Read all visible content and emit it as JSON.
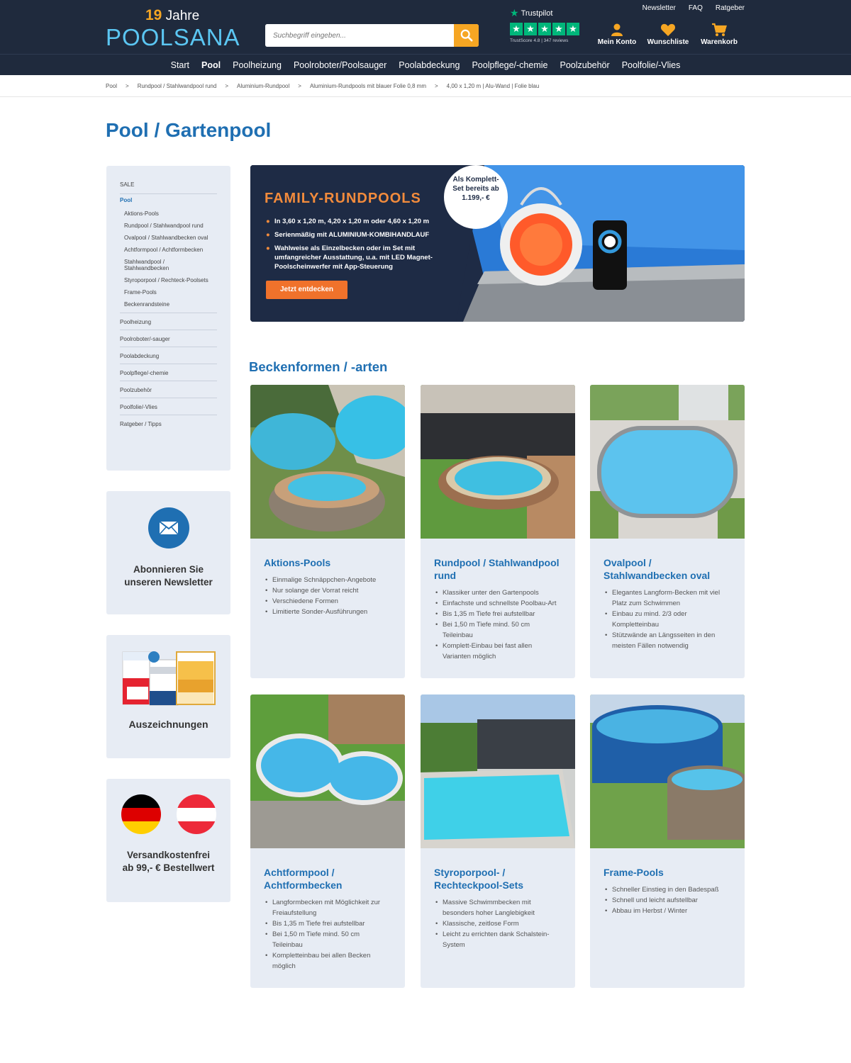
{
  "header": {
    "logo_years_num": "19",
    "logo_years_text": "Jahre",
    "logo_brand": "POOLSANA",
    "search_placeholder": "Suchbegriff eingeben...",
    "trustpilot_label": "Trustpilot",
    "trustpilot_score": "TrustScore 4.8 | 347 reviews",
    "top_links": [
      "Newsletter",
      "FAQ",
      "Ratgeber"
    ],
    "account_label": "Mein Konto",
    "wishlist_label": "Wunschliste",
    "cart_label": "Warenkorb"
  },
  "nav": {
    "items": [
      "Start",
      "Pool",
      "Poolheizung",
      "Poolroboter/Poolsauger",
      "Poolabdeckung",
      "Poolpflege/-chemie",
      "Poolzubehör",
      "Poolfolie/-Vlies"
    ],
    "active": "Pool"
  },
  "breadcrumb": [
    "Pool",
    "Rundpool / Stahlwandpool rund",
    "Aluminium-Rundpool",
    "Aluminium-Rundpools mit blauer Folie 0,8 mm",
    "4,00 x 1,20 m | Alu-Wand | Folie blau"
  ],
  "page_title": "Pool / Gartenpool",
  "sidebar": {
    "sale": "SALE",
    "active": "Pool",
    "sub": [
      "Aktions-Pools",
      "Rundpool / Stahlwandpool rund",
      "Ovalpool / Stahlwandbecken oval",
      "Achtformpool / Achtformbecken",
      "Stahlwandpool / Stahlwandbecken",
      "Styroporpool / Rechteck-Poolsets",
      "Frame-Pools",
      "Beckenrandsteine"
    ],
    "main": [
      "Poolheizung",
      "Poolroboter/-sauger",
      "Poolabdeckung",
      "Poolpflege/-chemie",
      "Poolzubehör",
      "Poolfolie/-Vlies",
      "Ratgeber / Tipps"
    ]
  },
  "newsletter_box": {
    "line1": "Abonnieren Sie",
    "line2": "unseren Newsletter"
  },
  "awards_box": {
    "label": "Auszeichnungen"
  },
  "shipping_box": {
    "line1": "Versandkostenfrei",
    "line2": "ab 99,- € Bestellwert"
  },
  "banner": {
    "title": "FAMILY-RUNDPOOLS",
    "bullets": [
      "In 3,60 x 1,20 m, 4,20 x 1,20 m oder 4,60 x 1,20 m",
      "Serienmäßig mit ALUMINIUM-KOMBIHANDLAUF",
      "Wahlweise als Einzelbecken oder im Set mit umfangreicher Ausstattung, u.a. mit LED Magnet-Poolscheinwerfer mit App-Steuerung"
    ],
    "cta": "Jetzt entdecken",
    "badge_line1": "Als Komplett-",
    "badge_line2": "Set bereits ab",
    "badge_price": "1.199,- €"
  },
  "section_title": "Beckenformen / -arten",
  "cards": [
    {
      "title": "Aktions-Pools",
      "bullets": [
        "Einmalige Schnäppchen-Angebote",
        "Nur solange der Vorrat reicht",
        "Verschiedene Formen",
        "Limitierte Sonder-Ausführungen"
      ]
    },
    {
      "title": "Rundpool / Stahlwandpool rund",
      "bullets": [
        "Klassiker unter den Gartenpools",
        "Einfachste und schnellste Poolbau-Art",
        "Bis 1,35 m Tiefe frei aufstellbar",
        "Bei 1,50 m Tiefe mind. 50 cm Teileinbau",
        "Komplett-Einbau bei fast allen Varianten möglich"
      ]
    },
    {
      "title": "Ovalpool / Stahlwandbecken oval",
      "bullets": [
        "Elegantes Langform-Becken mit viel Platz zum Schwimmen",
        "Einbau zu mind. 2/3 oder Kompletteinbau",
        "Stützwände an Längsseiten in den meisten Fällen notwendig"
      ]
    },
    {
      "title": "Achtformpool / Achtformbecken",
      "bullets": [
        "Langformbecken mit Möglichkeit zur Freiaufstellung",
        "Bis 1,35 m Tiefe frei aufstellbar",
        "Bei 1,50 m Tiefe mind. 50 cm Teileinbau",
        "Kompletteinbau bei allen Becken möglich"
      ]
    },
    {
      "title": "Styroporpool- / Rechteckpool-Sets",
      "bullets": [
        "Massive Schwimmbecken mit besonders hoher Langlebigkeit",
        "Klassische, zeitlose Form",
        "Leicht zu errichten dank Schalstein-System"
      ]
    },
    {
      "title": "Frame-Pools",
      "bullets": [
        "Schneller Einstieg in den Badespaß",
        "Schnell und leicht aufstellbar",
        "Abbau im Herbst / Winter"
      ]
    }
  ]
}
